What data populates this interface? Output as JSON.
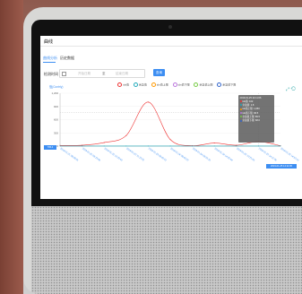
{
  "app": {
    "title": "曲线"
  },
  "tabs": [
    {
      "label": "曲线分析",
      "active": true
    },
    {
      "label": "历史数据",
      "active": false
    }
  ],
  "filter": {
    "label": "检测时间",
    "start_placeholder": "开始日期",
    "separator": "至",
    "end_placeholder": "结束日期",
    "query_label": "查询"
  },
  "legend": [
    "tds值",
    "余氯值",
    "tds值上限",
    "tds值下限",
    "余氯值上限",
    "余氯值下限"
  ],
  "toolbox_icons": [
    "data-zoom-icon",
    "restore-icon"
  ],
  "tooltip": {
    "time": "2019-01-25 14:11:06",
    "rows": [
      {
        "label": "tds值",
        "value": "102",
        "color": "#e33"
      },
      {
        "label": "余氯值",
        "value": "1.8",
        "color": "#2ab"
      },
      {
        "label": "tds值上限",
        "value": "1,050",
        "color": "#f90"
      },
      {
        "label": "tds值下限",
        "value": "96.5",
        "color": "#b7d"
      },
      {
        "label": "余氯值上限",
        "value": "89.5",
        "color": "#7c4"
      },
      {
        "label": "余氯值下限",
        "value": "68.0",
        "color": "#36c"
      }
    ]
  },
  "axis_pointer": {
    "y_label": "765.4",
    "x_label": "2019-01-25 14:11:06"
  },
  "colors": {
    "accent": "#3d8ef2",
    "tds": "#e33",
    "chlorine": "#2ab",
    "grid": "#eee"
  },
  "chart_data": {
    "type": "line",
    "ylabel": "值(Contrly)",
    "ylim": [
      0,
      1200
    ],
    "yticks": [
      "1,200",
      "900",
      "600",
      "300",
      "0"
    ],
    "categories": [
      "2019-01-21 08:08:05",
      "2019-01-22 08:13:46",
      "2019-01-22 10:23:40",
      "2019-01-22 11:15:02",
      "2019-01-23 08:40:01",
      "2019-01-24 08:43:22",
      "2019-01-24 08:55:10",
      "2019-01-24 14:32:44",
      "2019-01-25 10:21:05",
      "2019-01-25 14:11:06",
      "2019-01-25 14:52:10"
    ],
    "series": [
      {
        "name": "tds值",
        "values": [
          15,
          20,
          80,
          240,
          1000,
          150,
          10,
          70,
          20,
          102,
          8
        ]
      },
      {
        "name": "余氯值",
        "values": [
          2,
          2,
          2,
          2,
          2,
          2,
          2,
          2,
          2,
          1.8,
          2
        ]
      }
    ]
  }
}
